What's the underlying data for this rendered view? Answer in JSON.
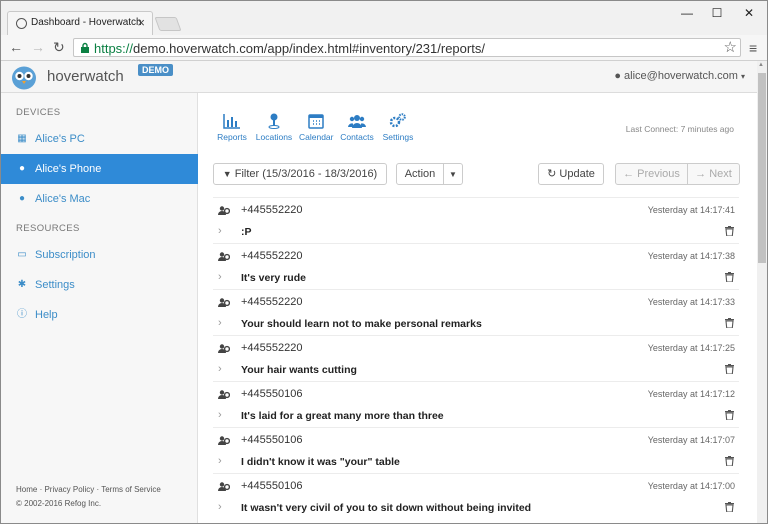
{
  "browser": {
    "tab_title": "Dashboard - Hoverwatch",
    "url_scheme": "https://",
    "url_rest": "demo.hoverwatch.com/app/index.html#inventory/231/reports/",
    "window_controls": [
      "—",
      "☐",
      "✕"
    ]
  },
  "header": {
    "brand": "hoverwatch",
    "badge": "DEMO",
    "user": "alice@hoverwatch.com"
  },
  "sidebar": {
    "devices_heading": "DEVICES",
    "devices": [
      {
        "label": "Alice's PC",
        "icon": "windows-icon"
      },
      {
        "label": "Alice's Phone",
        "icon": "android-icon"
      },
      {
        "label": "Alice's Mac",
        "icon": "apple-icon"
      }
    ],
    "resources_heading": "RESOURCES",
    "resources": [
      {
        "label": "Subscription",
        "icon": "card-icon"
      },
      {
        "label": "Settings",
        "icon": "gear-icon"
      },
      {
        "label": "Help",
        "icon": "info-icon"
      }
    ],
    "footer_links": "Home · Privacy Policy · Terms of Service",
    "copyright": "© 2002-2016 Refog Inc."
  },
  "toolbar": {
    "tools": [
      {
        "label": "Reports",
        "icon": "chart-icon"
      },
      {
        "label": "Locations",
        "icon": "location-icon"
      },
      {
        "label": "Calendar",
        "icon": "calendar-icon"
      },
      {
        "label": "Contacts",
        "icon": "contacts-icon"
      },
      {
        "label": "Settings",
        "icon": "gears-icon"
      }
    ],
    "last_connect": "Last Connect: 7 minutes ago"
  },
  "controls": {
    "filter": "Filter (15/3/2016 - 18/3/2016)",
    "action": "Action",
    "update": "Update",
    "previous": "Previous",
    "next": "Next"
  },
  "messages": [
    {
      "number": "+445552220",
      "time": "Yesterday at 14:17:41",
      "text": ":P"
    },
    {
      "number": "+445552220",
      "time": "Yesterday at 14:17:38",
      "text": "It's very rude"
    },
    {
      "number": "+445552220",
      "time": "Yesterday at 14:17:33",
      "text": "Your should learn not to make personal remarks"
    },
    {
      "number": "+445552220",
      "time": "Yesterday at 14:17:25",
      "text": "Your hair wants cutting"
    },
    {
      "number": "+445550106",
      "time": "Yesterday at 14:17:12",
      "text": "It's laid for a great many more than three"
    },
    {
      "number": "+445550106",
      "time": "Yesterday at 14:17:07",
      "text": "I didn't know it was \"your\" table"
    },
    {
      "number": "+445550106",
      "time": "Yesterday at 14:17:00",
      "text": "It wasn't very civil of you to sit down without being invited"
    }
  ],
  "colors": {
    "accent": "#2f8ad8",
    "link": "#3c8dc8",
    "badge": "#4a8fc7"
  }
}
